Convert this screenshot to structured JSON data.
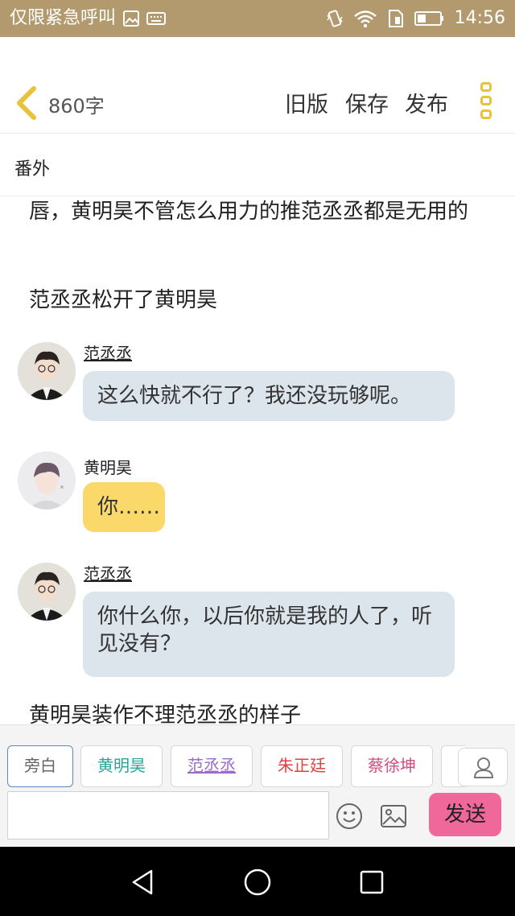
{
  "status_bar": {
    "left_text": "仅限紧急呼叫",
    "time": "14:56",
    "icons": [
      "image-icon",
      "keyboard-icon",
      "vibrate-icon",
      "wifi-icon",
      "sim-icon",
      "battery-icon"
    ]
  },
  "header": {
    "word_count": "860字",
    "old_version_label": "旧版",
    "save_label": "保存",
    "publish_label": "发布",
    "accent_color": "#e8c23c"
  },
  "chapter": {
    "title": "番外"
  },
  "content": {
    "narration_1": "唇，黄明昊不管怎么用力的推范丞丞都是无用的",
    "narration_2": "范丞丞松开了黄明昊",
    "messages": [
      {
        "name": "范丞丞",
        "text": "这么快就不行了？我还没玩够呢。",
        "style": "blue"
      },
      {
        "name": "黄明昊",
        "text": "你……",
        "style": "yellow"
      },
      {
        "name": "范丞丞",
        "text": "你什么你，以后你就是我的人了，听见没有？",
        "style": "blue"
      }
    ],
    "narration_3": "黄明昊装作不理范丞丞的样子"
  },
  "composer": {
    "chips": [
      "旁白",
      "黄明昊",
      "范丞丞",
      "朱正廷",
      "蔡徐坤"
    ],
    "input_value": "",
    "input_placeholder": "",
    "send_label": "发送",
    "send_color": "#f0689a"
  },
  "nav_bar": {
    "icons": [
      "back-triangle-icon",
      "home-circle-icon",
      "recent-square-icon"
    ]
  }
}
